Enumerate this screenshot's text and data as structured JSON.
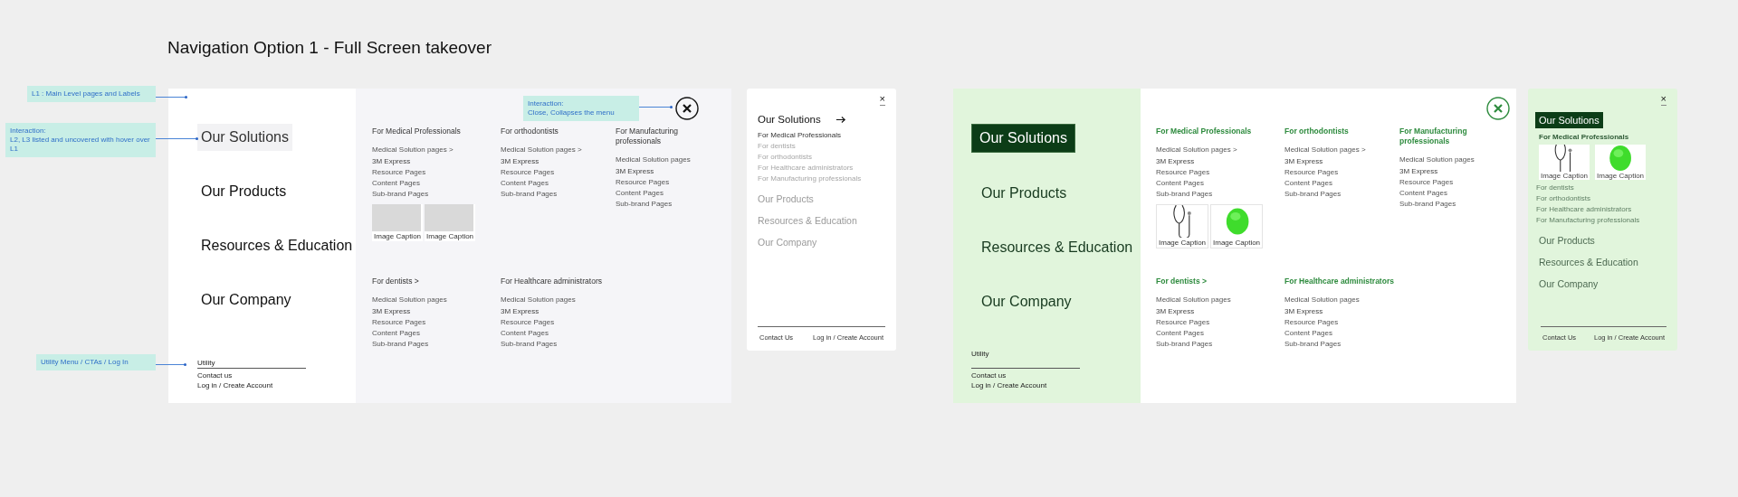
{
  "title": "Navigation Option 1 - Full Screen takeover",
  "annotations": [
    {
      "text": "L1 : Main Level pages and Labels"
    },
    {
      "text": "Interaction:\nL2, L3  listed and uncovered with hover over L1"
    },
    {
      "text": "Utility Menu / CTAs / Log In"
    },
    {
      "text": "Interaction:\nClose, Collapses the menu"
    }
  ],
  "wireframe": {
    "desktop": {
      "nav": [
        {
          "label": "Our Solutions",
          "selected": true
        },
        {
          "label": "Our Products",
          "selected": false
        },
        {
          "label": "Resources & Education",
          "selected": false
        },
        {
          "label": "Our Company",
          "selected": false
        }
      ],
      "utility": {
        "label": "Utility",
        "links": [
          "Contact us",
          "Log in / Create Account"
        ]
      },
      "groups": [
        {
          "heading": "For Medical Professionals",
          "link": "Medical Solution pages >",
          "items": [
            "3M Express",
            "Resource Pages",
            "Content Pages",
            "Sub-brand Pages"
          ],
          "images": [
            {
              "kind": "placeholder",
              "caption": "Image Caption"
            },
            {
              "kind": "placeholder",
              "caption": "Image Caption"
            }
          ]
        },
        {
          "heading": "For orthodontists",
          "link": "Medical Solution pages  >",
          "items": [
            "3M Express",
            "Resource Pages",
            "Content Pages",
            "Sub-brand Pages"
          ]
        },
        {
          "heading": "For Manufacturing professionals",
          "link": "Medical Solution pages",
          "items": [
            "3M Express",
            "Resource Pages",
            "Content Pages",
            "Sub-brand Pages"
          ]
        },
        {
          "heading": "For dentists  >",
          "link": "Medical Solution pages",
          "items": [
            "3M Express",
            "Resource Pages",
            "Content Pages",
            "Sub-brand Pages"
          ]
        },
        {
          "heading": "For Healthcare administrators",
          "link": "Medical Solution pages",
          "items": [
            "3M Express",
            "Resource Pages",
            "Content Pages",
            "Sub-brand Pages"
          ]
        }
      ]
    },
    "mobile": {
      "close": "×",
      "nav": [
        {
          "label": "Our Solutions",
          "selected": true,
          "arrow": true,
          "children": [
            {
              "label": "For Medical Professionals",
              "selected": true
            },
            {
              "label": "For dentists",
              "selected": false
            },
            {
              "label": "For orthodontists",
              "selected": false
            },
            {
              "label": "For Healthcare administrators",
              "selected": false
            },
            {
              "label": "For Manufacturing professionals",
              "selected": false
            }
          ]
        },
        {
          "label": "Our Products",
          "selected": false
        },
        {
          "label": "Resources & Education",
          "selected": false
        },
        {
          "label": "Our Company",
          "selected": false
        }
      ],
      "footer": [
        "Contact Us",
        "Log in / Create Account"
      ]
    }
  },
  "design": {
    "desktop": {
      "nav": [
        {
          "label": "Our Solutions",
          "selected": true
        },
        {
          "label": "Our Products",
          "selected": false
        },
        {
          "label": "Resources & Education",
          "selected": false
        },
        {
          "label": "Our Company",
          "selected": false
        }
      ],
      "utility": {
        "label": "Utility",
        "links": [
          "Contact us",
          "Log in / Create Account"
        ]
      },
      "groups": [
        {
          "heading": "For Medical Professionals",
          "link": "Medical Solution pages >",
          "items": [
            "3M Express",
            "Resource Pages",
            "Content Pages",
            "Sub-brand Pages"
          ],
          "images": [
            {
              "kind": "picture",
              "caption": "Image Caption"
            },
            {
              "kind": "picture",
              "caption": "Image Caption"
            }
          ]
        },
        {
          "heading": "For orthodontists",
          "link": "Medical Solution pages  >",
          "items": [
            "3M Express",
            "Resource Pages",
            "Content Pages",
            "Sub-brand Pages"
          ]
        },
        {
          "heading": "For Manufacturing professionals",
          "link": "Medical Solution pages",
          "items": [
            "3M Express",
            "Resource Pages",
            "Content Pages",
            "Sub-brand Pages"
          ]
        },
        {
          "heading": "For dentists  >",
          "link": "Medical Solution pages",
          "items": [
            "3M Express",
            "Resource Pages",
            "Content Pages",
            "Sub-brand Pages"
          ]
        },
        {
          "heading": "For Healthcare administrators",
          "link": "Medical Solution pages",
          "items": [
            "3M Express",
            "Resource Pages",
            "Content Pages",
            "Sub-brand Pages"
          ]
        }
      ]
    },
    "mobile": {
      "close": "×",
      "nav": [
        {
          "label": "Our Solutions",
          "selected": true,
          "children": [
            {
              "label": "For Medical Professionals",
              "selected": true,
              "images": [
                {
                  "kind": "picture",
                  "caption": "Image Caption"
                },
                {
                  "kind": "picture",
                  "caption": "Image Caption"
                }
              ]
            },
            {
              "label": "For dentists",
              "selected": false
            },
            {
              "label": "For orthodontists",
              "selected": false
            },
            {
              "label": "For Healthcare administrators",
              "selected": false
            },
            {
              "label": "For Manufacturing professionals",
              "selected": false
            }
          ]
        },
        {
          "label": "Our Products",
          "selected": false
        },
        {
          "label": "Resources & Education",
          "selected": false
        },
        {
          "label": "Our Company",
          "selected": false
        }
      ],
      "footer": [
        "Contact Us",
        "Log in / Create Account"
      ]
    }
  }
}
